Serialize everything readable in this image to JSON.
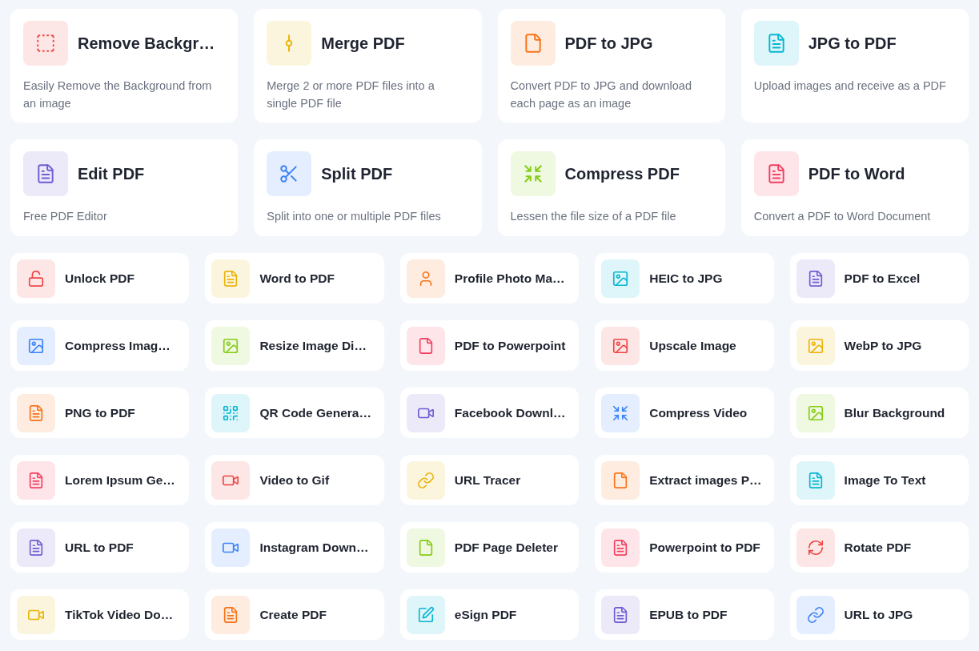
{
  "featured_tools": [
    {
      "title": "Remove Backgr…",
      "description": "Easily Remove the Background from an image",
      "color": "#ef4444"
    },
    {
      "title": "Merge PDF",
      "description": "Merge 2 or more PDF files into a single PDF file",
      "color": "#eab308"
    },
    {
      "title": "PDF to JPG",
      "description": "Convert PDF to JPG and download each page as an image",
      "color": "#f97316"
    },
    {
      "title": "JPG to PDF",
      "description": "Upload images and receive as a PDF",
      "color": "#06b6d4"
    },
    {
      "title": "Edit PDF",
      "description": "Free PDF Editor",
      "color": "#6d5dd3"
    },
    {
      "title": "Split PDF",
      "description": "Split into one or multiple PDF files",
      "color": "#3b82f6"
    },
    {
      "title": "Compress PDF",
      "description": "Lessen the file size of a PDF file",
      "color": "#84cc16"
    },
    {
      "title": "PDF to Word",
      "description": "Convert a PDF to Word Document",
      "color": "#f43f5e"
    }
  ],
  "tools": [
    {
      "title": "Unlock PDF",
      "color": "#ef4444"
    },
    {
      "title": "Word to PDF",
      "color": "#eab308"
    },
    {
      "title": "Profile Photo Ma…",
      "color": "#f97316"
    },
    {
      "title": "HEIC to JPG",
      "color": "#06b6d4"
    },
    {
      "title": "PDF to Excel",
      "color": "#6d5dd3"
    },
    {
      "title": "Compress Imag…",
      "color": "#3b82f6"
    },
    {
      "title": "Resize Image Di…",
      "color": "#84cc16"
    },
    {
      "title": "PDF to Powerpoint",
      "color": "#f43f5e"
    },
    {
      "title": "Upscale Image",
      "color": "#ef4444"
    },
    {
      "title": "WebP to JPG",
      "color": "#eab308"
    },
    {
      "title": "PNG to PDF",
      "color": "#f97316"
    },
    {
      "title": "QR Code Genera…",
      "color": "#06b6d4"
    },
    {
      "title": "Facebook Downl…",
      "color": "#6d5dd3"
    },
    {
      "title": "Compress Video",
      "color": "#3b82f6"
    },
    {
      "title": "Blur Background",
      "color": "#84cc16"
    },
    {
      "title": "Lorem Ipsum Ge…",
      "color": "#f43f5e"
    },
    {
      "title": "Video to Gif",
      "color": "#ef4444"
    },
    {
      "title": "URL Tracer",
      "color": "#eab308"
    },
    {
      "title": "Extract images P…",
      "color": "#f97316"
    },
    {
      "title": "Image To Text",
      "color": "#06b6d4"
    },
    {
      "title": "URL to PDF",
      "color": "#6d5dd3"
    },
    {
      "title": "Instagram Down…",
      "color": "#3b82f6"
    },
    {
      "title": "PDF Page Deleter",
      "color": "#84cc16"
    },
    {
      "title": "Powerpoint to PDF",
      "color": "#f43f5e"
    },
    {
      "title": "Rotate PDF",
      "color": "#ef4444"
    },
    {
      "title": "TikTok Video Do…",
      "color": "#eab308"
    },
    {
      "title": "Create PDF",
      "color": "#f97316"
    },
    {
      "title": "eSign PDF",
      "color": "#06b6d4"
    },
    {
      "title": "EPUB to PDF",
      "color": "#6d5dd3"
    },
    {
      "title": "URL to JPG",
      "color": "#3b82f6"
    }
  ]
}
